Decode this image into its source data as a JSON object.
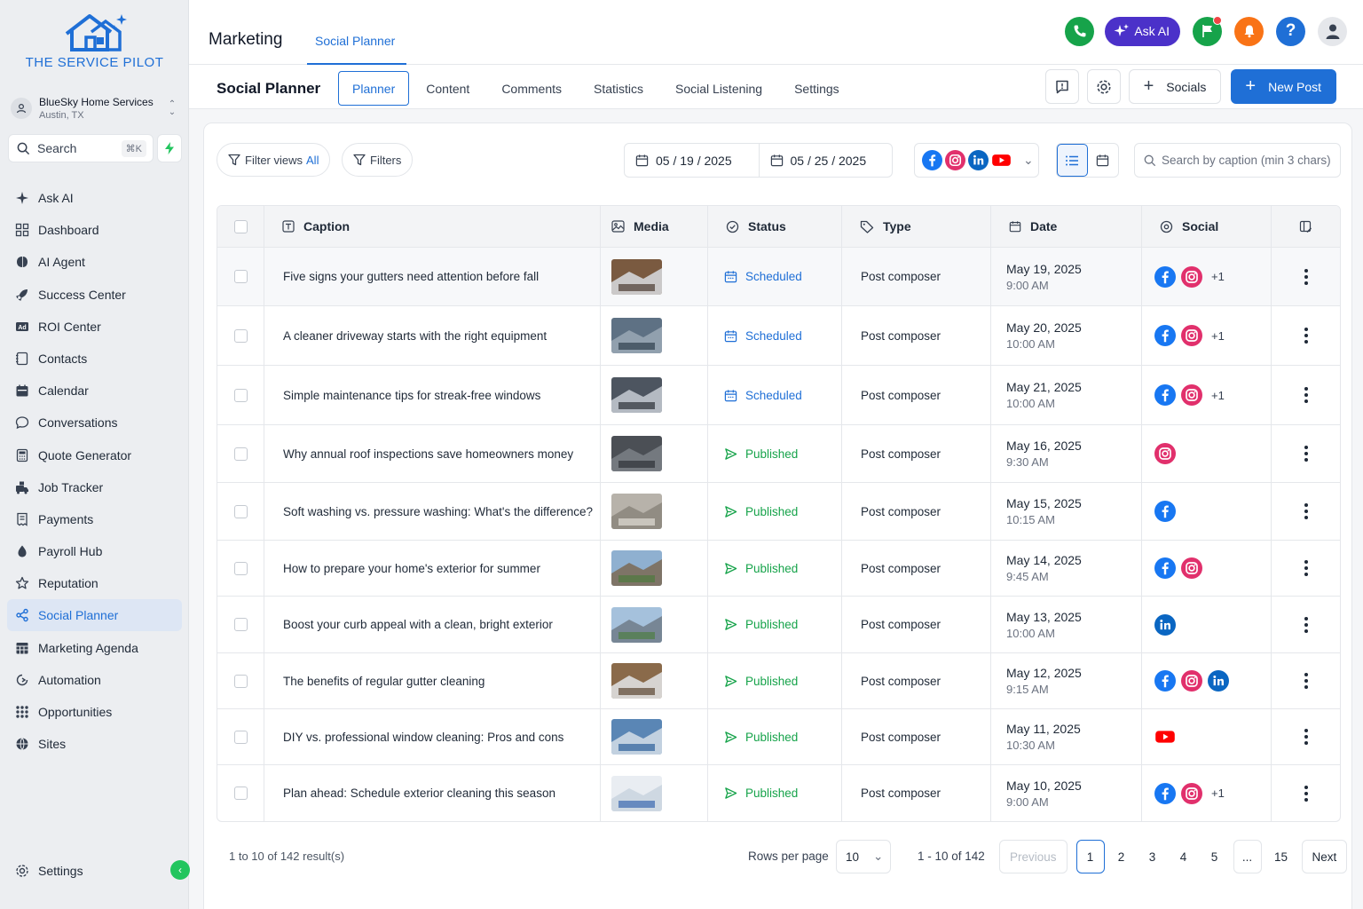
{
  "brand": {
    "name": "THE SERVICE PILOT",
    "color": "#1f6fd6"
  },
  "account": {
    "name": "BlueSky Home Services",
    "location": "Austin, TX"
  },
  "sidebar_search": {
    "label": "Search",
    "shortcut": "⌘K"
  },
  "nav": [
    {
      "label": "Ask AI",
      "icon": "sparkle-icon"
    },
    {
      "label": "Dashboard",
      "icon": "grid-icon"
    },
    {
      "label": "AI Agent",
      "icon": "brain-icon"
    },
    {
      "label": "Success Center",
      "icon": "rocket-icon"
    },
    {
      "label": "ROI Center",
      "icon": "ad-icon"
    },
    {
      "label": "Contacts",
      "icon": "contacts-icon"
    },
    {
      "label": "Calendar",
      "icon": "calendar-icon"
    },
    {
      "label": "Conversations",
      "icon": "chat-icon"
    },
    {
      "label": "Quote Generator",
      "icon": "calculator-icon"
    },
    {
      "label": "Job Tracker",
      "icon": "tracker-icon"
    },
    {
      "label": "Payments",
      "icon": "receipt-icon"
    },
    {
      "label": "Payroll Hub",
      "icon": "payroll-icon"
    },
    {
      "label": "Reputation",
      "icon": "star-icon"
    },
    {
      "label": "Social Planner",
      "icon": "share-icon",
      "active": true
    },
    {
      "label": "Marketing Agenda",
      "icon": "agenda-icon"
    },
    {
      "label": "Automation",
      "icon": "automation-icon"
    },
    {
      "label": "Opportunities",
      "icon": "opportunities-icon"
    },
    {
      "label": "Sites",
      "icon": "globe-icon"
    }
  ],
  "sidebar_settings": "Settings",
  "top": {
    "title": "Marketing",
    "tab": "Social Planner",
    "ask_ai": "Ask AI"
  },
  "sub": {
    "title": "Social Planner",
    "tabs": [
      "Planner",
      "Content",
      "Comments",
      "Statistics",
      "Social Listening",
      "Settings"
    ],
    "active_tab": "Planner",
    "socials_btn": "Socials",
    "new_post_btn": "New Post"
  },
  "filters": {
    "filter_views": "Filter views",
    "filter_views_value": "All",
    "filters": "Filters",
    "date_from": "05 / 19 / 2025",
    "date_to": "05 / 25 / 2025",
    "search_placeholder": "Search by caption (min 3 chars)"
  },
  "table": {
    "headers": [
      "Caption",
      "Media",
      "Status",
      "Type",
      "Date",
      "Social"
    ],
    "rows": [
      {
        "caption": "Five signs your gutters need attention before fall",
        "media": "gutter",
        "status": "Scheduled",
        "type": "Post composer",
        "date": "May 19, 2025",
        "time": "9:00 AM",
        "social": [
          "facebook",
          "instagram"
        ],
        "more": "+1"
      },
      {
        "caption": "A cleaner driveway starts with the right equipment",
        "media": "driveway",
        "status": "Scheduled",
        "type": "Post composer",
        "date": "May 20, 2025",
        "time": "10:00 AM",
        "social": [
          "facebook",
          "instagram"
        ],
        "more": "+1"
      },
      {
        "caption": "Simple maintenance tips for streak-free windows",
        "media": "window",
        "status": "Scheduled",
        "type": "Post composer",
        "date": "May 21, 2025",
        "time": "10:00 AM",
        "social": [
          "facebook",
          "instagram"
        ],
        "more": "+1"
      },
      {
        "caption": "Why annual roof inspections save homeowners money",
        "media": "roof",
        "status": "Published",
        "type": "Post composer",
        "date": "May 16, 2025",
        "time": "9:30 AM",
        "social": [
          "instagram"
        ],
        "more": ""
      },
      {
        "caption": "Soft washing vs. pressure washing: What's the difference?",
        "media": "siding",
        "status": "Published",
        "type": "Post composer",
        "date": "May 15, 2025",
        "time": "10:15 AM",
        "social": [
          "facebook"
        ],
        "more": ""
      },
      {
        "caption": "How to prepare your home's exterior for summer",
        "media": "house",
        "status": "Published",
        "type": "Post composer",
        "date": "May 14, 2025",
        "time": "9:45 AM",
        "social": [
          "facebook",
          "instagram"
        ],
        "more": ""
      },
      {
        "caption": "Boost your curb appeal with a clean, bright exterior",
        "media": "house2",
        "status": "Published",
        "type": "Post composer",
        "date": "May 13, 2025",
        "time": "10:00 AM",
        "social": [
          "linkedin"
        ],
        "more": ""
      },
      {
        "caption": "The benefits of regular gutter cleaning",
        "media": "gutter2",
        "status": "Published",
        "type": "Post composer",
        "date": "May 12, 2025",
        "time": "9:15 AM",
        "social": [
          "facebook",
          "instagram",
          "linkedin"
        ],
        "more": ""
      },
      {
        "caption": "DIY vs. professional window cleaning: Pros and cons",
        "media": "cleaner",
        "status": "Published",
        "type": "Post composer",
        "date": "May 11, 2025",
        "time": "10:30 AM",
        "social": [
          "youtube"
        ],
        "more": ""
      },
      {
        "caption": "Plan ahead: Schedule exterior cleaning this season",
        "media": "calendar",
        "status": "Published",
        "type": "Post composer",
        "date": "May 10, 2025",
        "time": "9:00 AM",
        "social": [
          "facebook",
          "instagram"
        ],
        "more": "+1"
      }
    ]
  },
  "footer": {
    "results": "1 to 10 of 142 result(s)",
    "rows_per_page_label": "Rows per page",
    "rows_per_page": "10",
    "range": "1 - 10 of 142",
    "previous": "Previous",
    "pages": [
      "1",
      "2",
      "3",
      "4",
      "5",
      "...",
      "15"
    ],
    "current_page": "1",
    "next": "Next"
  },
  "colors": {
    "accent": "#1f6fd6",
    "published": "#16a34a",
    "ask_ai": "#4b31c9",
    "phone": "#16a34a",
    "flag": "#16a34a",
    "bell": "#f97316",
    "help": "#1f6fd6"
  }
}
